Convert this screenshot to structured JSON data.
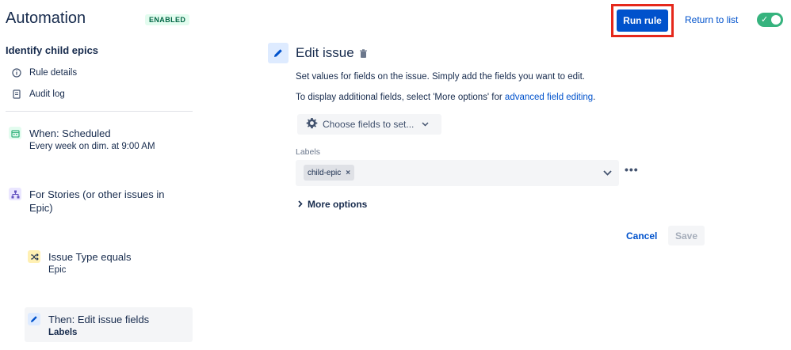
{
  "header": {
    "title": "Automation",
    "status_badge": "ENABLED",
    "run_rule_label": "Run rule",
    "return_label": "Return to list",
    "toggle_state": "on"
  },
  "sidebar": {
    "rule_name": "Identify child epics",
    "links": [
      {
        "label": "Rule details",
        "icon": "info-icon"
      },
      {
        "label": "Audit log",
        "icon": "document-icon"
      }
    ],
    "steps": [
      {
        "title": "When: Scheduled",
        "subtitle": "Every week on dim. at 9:00 AM",
        "icon": "calendar-icon",
        "color": "#36b37e"
      },
      {
        "title_line1": "For Stories (or other issues in",
        "title_line2": "Epic)",
        "icon": "hierarchy-icon",
        "color": "#6554c0"
      },
      {
        "title": "Issue Type equals",
        "subtitle": "Epic",
        "icon": "shuffle-icon",
        "color": "#ffab00"
      },
      {
        "title": "Then: Edit issue fields",
        "subtitle": "Labels",
        "icon": "pencil-icon",
        "color": "#0052cc"
      }
    ]
  },
  "panel": {
    "title": "Edit issue",
    "description": "Set values for fields on the issue. Simply add the fields you want to edit.",
    "additional_prefix": "To display additional fields, select 'More options' for ",
    "additional_link": "advanced field editing",
    "additional_suffix": ".",
    "choose_fields_label": "Choose fields to set...",
    "labels_field_label": "Labels",
    "labels_values": [
      "child-epic"
    ],
    "more_options_label": "More options",
    "cancel_label": "Cancel",
    "save_label": "Save"
  },
  "colors": {
    "primary": "#0052cc",
    "success": "#36b37e",
    "highlight": "#e5281b"
  }
}
